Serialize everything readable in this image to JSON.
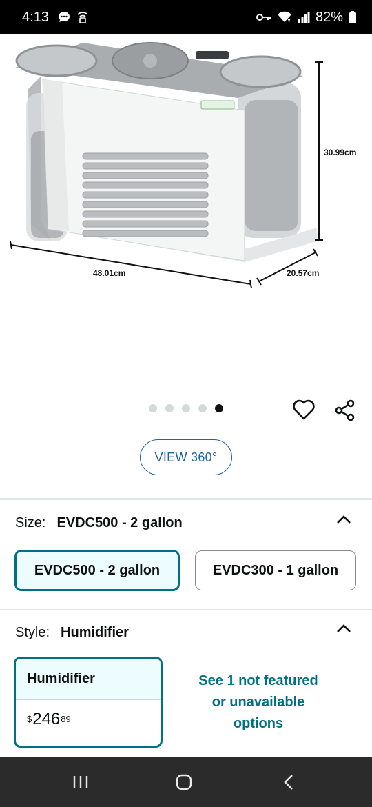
{
  "status_bar": {
    "time": "4:13",
    "battery": "82%",
    "left_icons": [
      "chat-bubble-icon",
      "lock-wifi-icon"
    ],
    "right_icons": [
      "key-icon",
      "wifi-icon",
      "signal-icon",
      "battery-icon"
    ]
  },
  "product_image": {
    "dimensions": {
      "height": "30.99cm",
      "width": "48.01cm",
      "depth": "20.57cm"
    },
    "carousel_count": 5,
    "carousel_active_index": 4
  },
  "actions": {
    "view360_label": "VIEW 360°"
  },
  "size": {
    "label": "Size:",
    "value": "EVDC500 - 2 gallon",
    "options": [
      "EVDC500 - 2 gallon",
      "EVDC300 - 1 gallon"
    ]
  },
  "style": {
    "label": "Style:",
    "value": "Humidifier",
    "card": {
      "title": "Humidifier",
      "price_symbol": "$",
      "price_whole": "246",
      "price_fraction": "89"
    },
    "see_more_lines": [
      "See 1 not featured",
      "or unavailable",
      "options"
    ]
  },
  "colors": {
    "accent_teal": "#007185",
    "link_blue": "#2162a1",
    "selected_bg": "#edfdff"
  }
}
